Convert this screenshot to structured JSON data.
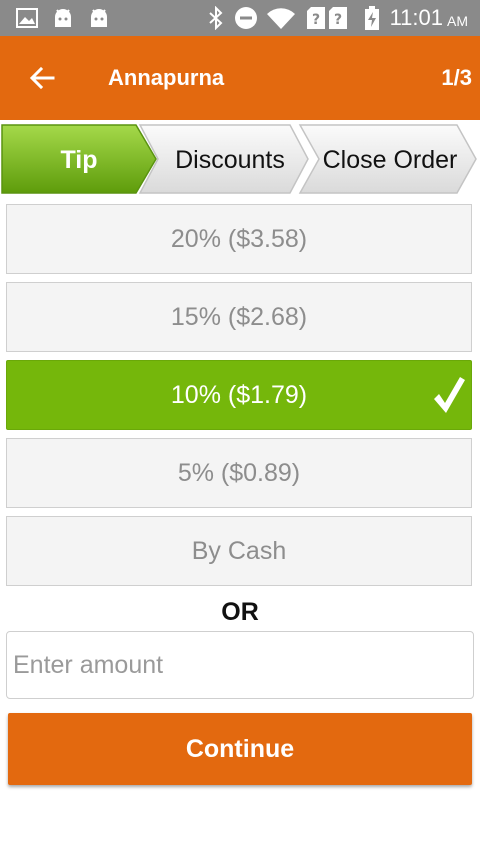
{
  "status_bar": {
    "time": "11:01",
    "ampm": "AM",
    "icons": [
      "gallery-icon",
      "android-icon",
      "android-icon",
      "bluetooth-icon",
      "do-not-disturb-icon",
      "wifi-icon",
      "no-sim-icon",
      "no-sim-icon",
      "battery-charging-icon"
    ]
  },
  "app_bar": {
    "title": "Annapurna",
    "page_count": "1/3"
  },
  "steps": [
    {
      "label": "Tip",
      "active": true
    },
    {
      "label": "Discounts",
      "active": false
    },
    {
      "label": "Close Order",
      "active": false
    }
  ],
  "tip_options": [
    {
      "label": "20% ($3.58)",
      "selected": false
    },
    {
      "label": "15% ($2.68)",
      "selected": false
    },
    {
      "label": "10% ($1.79)",
      "selected": true
    },
    {
      "label": "5% ($0.89)",
      "selected": false
    },
    {
      "label": "By Cash",
      "selected": false
    }
  ],
  "or_text": "OR",
  "amount_input": {
    "value": "",
    "placeholder": "Enter amount"
  },
  "continue_label": "Continue",
  "colors": {
    "accent_orange": "#e3690f",
    "selected_green": "#75b70b",
    "status_bar_gray": "#8a8a8a"
  }
}
